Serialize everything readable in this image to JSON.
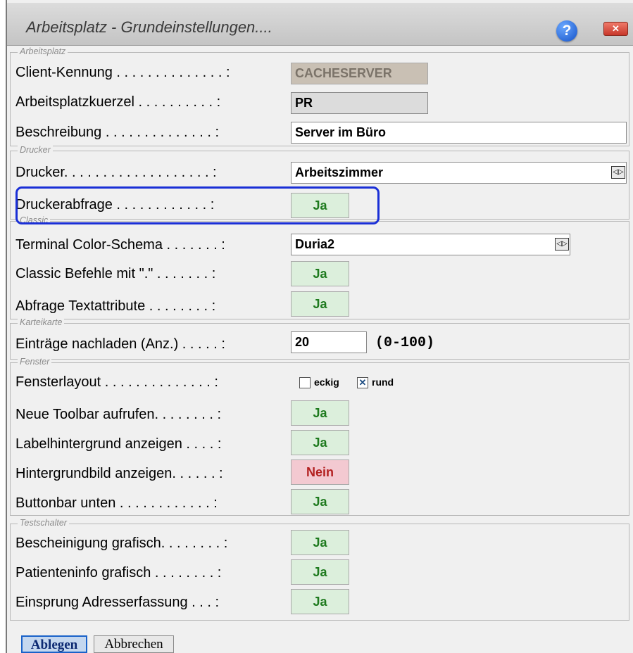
{
  "window": {
    "title": "Arbeitsplatz - Grundeinstellungen....",
    "help_glyph": "?",
    "close_glyph": "✕"
  },
  "groups": {
    "arbeitsplatz": "Arbeitsplatz",
    "drucker": "Drucker",
    "classic": "Classic",
    "karteikarte": "Karteikarte",
    "fenster": "Fenster",
    "testschalter": "Testschalter"
  },
  "rows": {
    "client_kennung": {
      "label": "Client-Kennung . . . . . . . . . . . . . . :",
      "value": "CACHESERVER"
    },
    "arbeitsplatzkuerzel": {
      "label": "Arbeitsplatzkuerzel . . . . . . . . . . :",
      "value": "PR"
    },
    "beschreibung": {
      "label": "Beschreibung . . . . . . . . . . . . . . :",
      "value": "Server im Büro"
    },
    "drucker": {
      "label": "Drucker. . . . . . . . . . . . . . . . . . . :",
      "value": "Arbeitszimmer"
    },
    "druckerabfrage": {
      "label": "Druckerabfrage . . . . . . . . . . . . :",
      "value": "Ja"
    },
    "terminal_color": {
      "label": "Terminal Color-Schema . . . . . . . :",
      "value": "Duria2"
    },
    "classic_befehle": {
      "label": "Classic Befehle mit \".\" . . . . . . . :",
      "value": "Ja"
    },
    "abfrage_textattribute": {
      "label": "Abfrage Textattribute . . . . . . . . :",
      "value": "Ja"
    },
    "eintraege_nachladen": {
      "label": "Einträge nachladen (Anz.) . . . . . :",
      "value": "20",
      "hint": "(0-100)"
    },
    "fensterlayout": {
      "label": "Fensterlayout . . . . . . . . . . . . . . :",
      "option_eckig": "eckig",
      "option_rund": "rund",
      "eckig_checked": false,
      "rund_checked": true
    },
    "neue_toolbar": {
      "label": "Neue Toolbar aufrufen. . . . . . . . :",
      "value": "Ja"
    },
    "labelhintergrund": {
      "label": "Labelhintergrund anzeigen . . . . :",
      "value": "Ja"
    },
    "hintergrundbild": {
      "label": "Hintergrundbild anzeigen. . . . . . :",
      "value": "Nein"
    },
    "buttonbar_unten": {
      "label": "Buttonbar unten . . . . . . . . . . . . :",
      "value": "Ja"
    },
    "bescheinigung": {
      "label": "Bescheinigung grafisch. . . . . . . . :",
      "value": "Ja"
    },
    "patienteninfo": {
      "label": "Patienteninfo grafisch . . . . . . . . :",
      "value": "Ja"
    },
    "einsprung": {
      "label": "Einsprung Adresserfassung . . . :",
      "value": "Ja"
    }
  },
  "buttons": {
    "ablegen": "Ablegen",
    "abbrechen": "Abbrechen"
  },
  "icons": {
    "help": "help-icon",
    "close": "close-icon",
    "spinner": "spinner-arrows-icon"
  },
  "colors": {
    "highlight": "#1a2fd6",
    "yes_bg": "#dcefdc",
    "no_bg": "#f3c9d1"
  }
}
